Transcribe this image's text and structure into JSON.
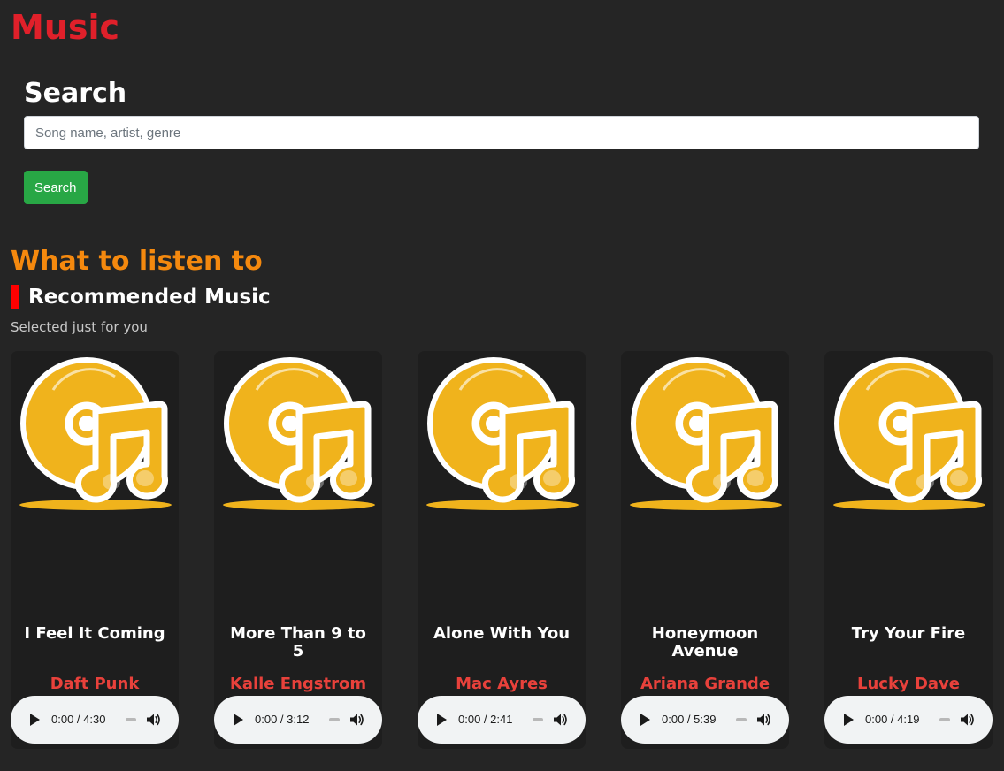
{
  "app": {
    "title": "Music"
  },
  "search": {
    "heading": "Search",
    "placeholder": "Song name, artist, genre",
    "value": "",
    "button_label": "Search",
    "button_color": "#28a745"
  },
  "recommend": {
    "section_title": "What to listen to",
    "subheading": "Recommended Music",
    "caption": "Selected just for you"
  },
  "colors": {
    "background": "#252525",
    "card_background": "#1e1e1e",
    "app_title": "#e0202a",
    "section_title": "#f5890e",
    "accent_bar": "#ff0000",
    "artist": "#e8413b",
    "artwork_gold": "#f0b31c"
  },
  "tracks": [
    {
      "title": "I Feel It Coming",
      "artist": "Daft Punk",
      "time": "0:00 / 4:30",
      "art_icon": "music-disc-icon"
    },
    {
      "title": "More Than 9 to 5",
      "artist": "Kalle Engstrom",
      "time": "0:00 / 3:12",
      "art_icon": "music-disc-icon"
    },
    {
      "title": "Alone With You",
      "artist": "Mac Ayres",
      "time": "0:00 / 2:41",
      "art_icon": "music-disc-icon"
    },
    {
      "title": "Honeymoon Avenue",
      "artist": "Ariana Grande",
      "time": "0:00 / 5:39",
      "art_icon": "music-disc-icon"
    },
    {
      "title": "Try Your Fire",
      "artist": "Lucky Dave",
      "time": "0:00 / 4:19",
      "art_icon": "music-disc-icon"
    }
  ]
}
